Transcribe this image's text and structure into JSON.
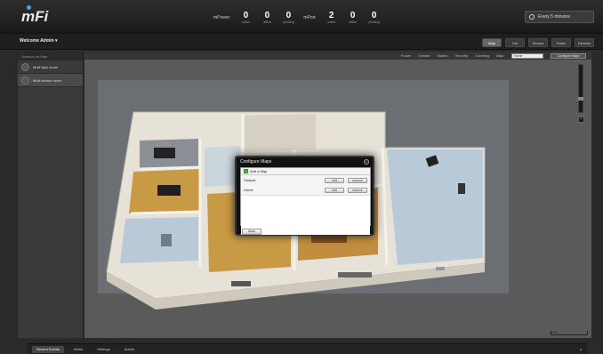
{
  "app": {
    "logo": "mFi"
  },
  "stats": {
    "mpower_label": "mPower",
    "mpower": [
      {
        "value": "0",
        "label": "online"
      },
      {
        "value": "0",
        "label": "offline"
      },
      {
        "value": "0",
        "label": "pending"
      }
    ],
    "mport_label": "mPort",
    "mport": [
      {
        "value": "2",
        "label": "online"
      },
      {
        "value": "0",
        "label": "offline"
      },
      {
        "value": "0",
        "label": "pending"
      }
    ]
  },
  "time_range": "Every 5 minutes",
  "header": {
    "welcome": "Welcome Admin ▾",
    "tabs": [
      "Map",
      "List",
      "Sensor",
      "Rules",
      "Devices"
    ]
  },
  "sidebar": {
    "header": "Sensors on Map",
    "items": [
      {
        "label": "Multi light mode"
      },
      {
        "label": "Multi sensor room"
      }
    ]
  },
  "maptools": {
    "items": [
      "Power",
      "Climate",
      "Motion",
      "Security",
      "Counting"
    ],
    "map_label": "Map:",
    "map_select": "Home",
    "configure": "Configure Maps"
  },
  "dialog": {
    "title": "Configure Maps",
    "add_label": "Add a Map",
    "maps": [
      {
        "name": "Sample",
        "edit": "edit",
        "remove": "remove"
      },
      {
        "name": "Home",
        "edit": "edit",
        "remove": "remove"
      }
    ],
    "close": "close"
  },
  "scale": "10m",
  "bottom": {
    "tabs": [
      "Recent Events",
      "Alerts",
      "Settings",
      "Admin"
    ]
  },
  "colors": {
    "accent": "#4aa3e8",
    "floor_wood": "#c89a45",
    "floor_tile": "#b9c9d8",
    "wall": "#e6e2d8"
  }
}
